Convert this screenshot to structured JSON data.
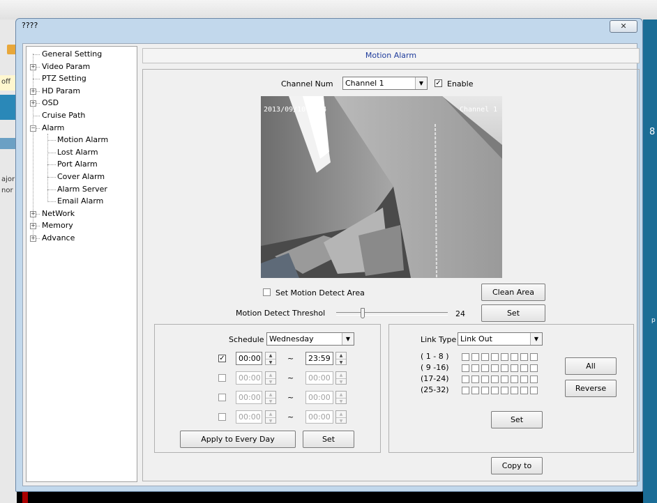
{
  "window": {
    "title": "????",
    "close_label": "✕"
  },
  "background": {
    "left_text_1": "off",
    "left_text_2": "ajor",
    "left_text_3": "nor",
    "right_text_1": "8",
    "right_text_2": "p"
  },
  "tree": {
    "items": [
      {
        "label": "General Setting"
      },
      {
        "label": "Video Param"
      },
      {
        "label": "PTZ Setting"
      },
      {
        "label": "HD Param"
      },
      {
        "label": "OSD"
      },
      {
        "label": "Cruise Path"
      },
      {
        "label": "Alarm"
      },
      {
        "label": "Motion Alarm"
      },
      {
        "label": "Lost Alarm"
      },
      {
        "label": "Port Alarm"
      },
      {
        "label": "Cover Alarm"
      },
      {
        "label": "Alarm Server"
      },
      {
        "label": "Email Alarm"
      },
      {
        "label": "NetWork"
      },
      {
        "label": "Memory"
      },
      {
        "label": "Advance"
      }
    ],
    "expand_plus": "+",
    "expand_minus": "−"
  },
  "header": {
    "title": "Motion Alarm"
  },
  "channel": {
    "label": "Channel Num",
    "value": "Channel  1",
    "enable_label": "Enable",
    "enable_checked": true
  },
  "video": {
    "osd_time": "2013/09/10 10:4",
    "osd_channel": "Channel 1"
  },
  "motion_area": {
    "label": "Set Motion Detect Area",
    "checked": false,
    "clean_label": "Clean Area"
  },
  "threshold": {
    "label": "Motion Detect Threshol",
    "value": "24",
    "fraction": 0.24,
    "set_label": "Set"
  },
  "schedule": {
    "label": "Schedule",
    "day": "Wednesday",
    "rows": [
      {
        "checked": true,
        "start": "00:00",
        "end": "23:59",
        "enabled": true
      },
      {
        "checked": false,
        "start": "00:00",
        "end": "00:00",
        "enabled": false
      },
      {
        "checked": false,
        "start": "00:00",
        "end": "00:00",
        "enabled": false
      },
      {
        "checked": false,
        "start": "00:00",
        "end": "00:00",
        "enabled": false
      }
    ],
    "separator": "~",
    "apply_label": "Apply to Every Day",
    "set_label": "Set"
  },
  "link": {
    "label": "Link Type",
    "value": "Link Out",
    "ranges": [
      "( 1 - 8 )",
      "( 9 -16)",
      "(17-24)",
      "(25-32)"
    ],
    "all_label": "All",
    "reverse_label": "Reverse",
    "set_label": "Set"
  },
  "footer": {
    "copy_label": "Copy to"
  }
}
